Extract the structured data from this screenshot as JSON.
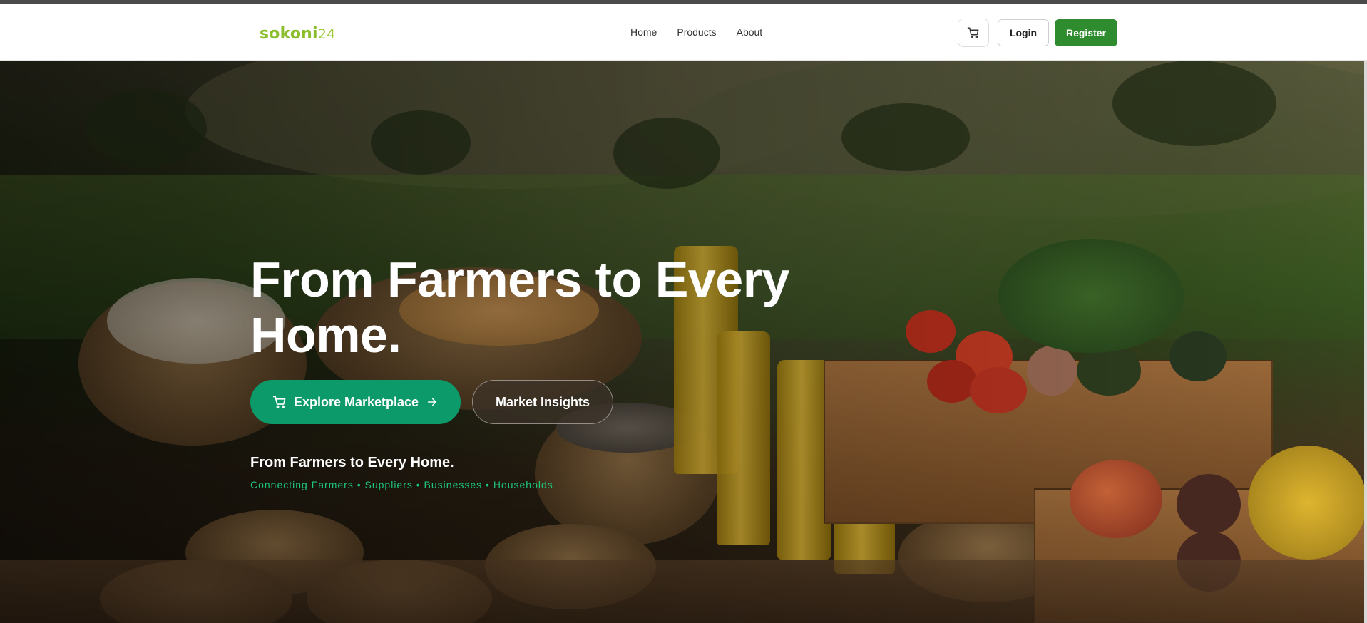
{
  "brand": {
    "logo_main": "sokoni",
    "logo_suffix": "24"
  },
  "nav": {
    "links": [
      "Home",
      "Products",
      "About"
    ],
    "login_label": "Login",
    "register_label": "Register"
  },
  "hero": {
    "title": "From Farmers to Every Home.",
    "primary_cta": "Explore Marketplace",
    "secondary_cta": "Market Insights",
    "subtitle": "From Farmers to Every Home.",
    "tagline": "Connecting Farmers • Suppliers • Businesses • Households"
  },
  "icons": {
    "cart": "cart-icon",
    "arrow": "arrow-right-icon"
  },
  "colors": {
    "brand_green": "#8bbe2c",
    "register_bg": "#2e8b2e",
    "cta_bg": "#0c9a6a",
    "tagline": "#1ec47a"
  }
}
